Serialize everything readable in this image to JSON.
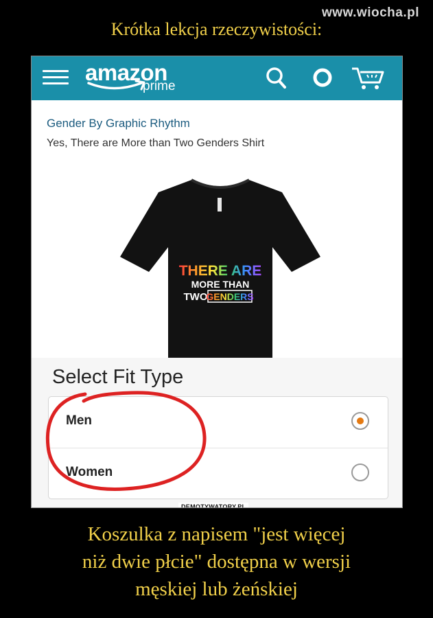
{
  "watermark": "www.wiocha.pl",
  "top_title": "Krótka lekcja rzeczywistości:",
  "amazon_header": {
    "logo_word": "amazon",
    "logo_sub": "prime",
    "icons": [
      "menu-icon",
      "search-icon",
      "alexa-icon",
      "cart-icon"
    ],
    "bar_color": "#1a8fa9"
  },
  "product": {
    "brand": "Gender By Graphic Rhythm",
    "title": "Yes, There are More than Two Genders Shirt",
    "shirt_print": [
      "THERE ARE",
      "MORE THAN",
      "TWO",
      "GENDERS"
    ]
  },
  "fit": {
    "heading": "Select Fit Type",
    "options": [
      {
        "label": "Men",
        "selected": true
      },
      {
        "label": "Women",
        "selected": false
      }
    ],
    "radio_selected_color": "#e47911"
  },
  "credit": "DEMOTYWATORY.PL",
  "caption": {
    "lines": [
      "Koszulka z napisem \"jest więcej",
      "niż dwie płcie\" dostępna w wersji",
      "męskiej lub żeńskiej"
    ]
  }
}
